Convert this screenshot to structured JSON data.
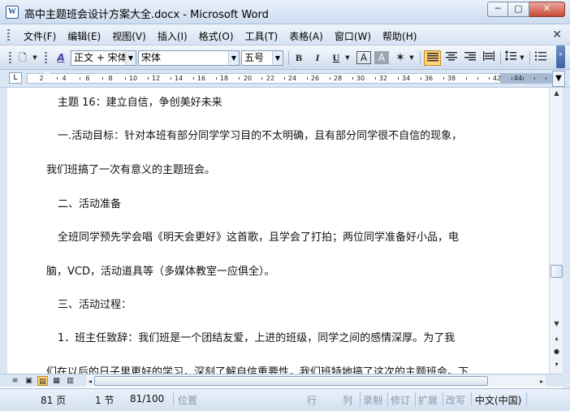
{
  "window": {
    "icon_letter": "W",
    "title": "高中主题班会设计方案大全.docx - Microsoft Word",
    "min_glyph": "─",
    "max_glyph": "▢",
    "close_glyph": "✕"
  },
  "menu": {
    "items": [
      "文件(F)",
      "编辑(E)",
      "视图(V)",
      "插入(I)",
      "格式(O)",
      "工具(T)",
      "表格(A)",
      "窗口(W)",
      "帮助(H)"
    ],
    "close_glyph": "✕"
  },
  "toolbar": {
    "new_glyph": "🗋",
    "style_icon_glyph": "A",
    "style_value": "正文 + 宋体",
    "font_value": "宋体",
    "size_value": "五号",
    "bold": "B",
    "italic": "I",
    "underline": "U",
    "font_color": "A",
    "char_shading": "A",
    "highlight": "✶",
    "dropdown_glyph": "▼",
    "overflow_glyph": "»"
  },
  "ruler": {
    "corner_glyph": "L",
    "numbers": [
      "2",
      "4",
      "6",
      "8",
      "10",
      "12",
      "14",
      "16",
      "18",
      "20",
      "22",
      "24",
      "26",
      "28",
      "30",
      "32",
      "34",
      "36",
      "38",
      "42",
      "44"
    ]
  },
  "document": {
    "lines": [
      "主题 16：建立自信，争创美好未来",
      "一.活动目标：针对本班有部分同学学习目的不太明确，且有部分同学很不自信的现象，",
      "我们班搞了一次有意义的主题班会。",
      "二、活动准备",
      "全班同学预先学会唱《明天会更好》这首歌，且学会了打拍；两位同学准备好小品，电",
      "脑，VCD，活动道具等（多媒体教室一应俱全）。",
      "三、活动过程：",
      "1．班主任致辞：我们班是一个团结友爱，上进的班级，同学之间的感情深厚。为了我",
      "们在以后的日子里更好的学习，深刻了解自信重要性，我们班特地搞了这次的主题班会。下"
    ]
  },
  "scrollbar": {
    "up": "▲",
    "down": "▼",
    "prev_page": "▴",
    "browse": "●",
    "next_page": "▾",
    "left": "◂",
    "right": "▸"
  },
  "view_buttons": [
    "≡",
    "▣",
    "▤",
    "▦",
    "▥"
  ],
  "status": {
    "page": "81 页",
    "section": "1 节",
    "page_of": "81/100",
    "position": "位置",
    "line": "行",
    "column": "列",
    "record": "录制",
    "revision": "修订",
    "extend": "扩展",
    "overtype": "改写",
    "language": "中文(中国)"
  },
  "colors": {
    "accent": "#ffd37a",
    "chrome": "#dbe6f4"
  }
}
